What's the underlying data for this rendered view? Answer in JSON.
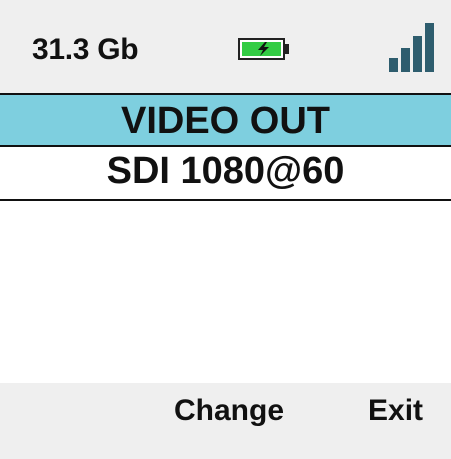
{
  "status_bar": {
    "storage": "31.3 Gb",
    "battery_icon": "battery-charging-icon",
    "signal_icon": "signal-strength-icon",
    "signal_bars": 4
  },
  "menu": {
    "title": "VIDEO OUT",
    "selected_value": "SDI 1080@60"
  },
  "softkeys": {
    "change_label": "Change",
    "exit_label": "Exit"
  },
  "colors": {
    "title_bar": "#7ecfdf",
    "status_bar": "#efefef",
    "battery_fill": "#33cc44",
    "signal": "#2e5d6e"
  }
}
